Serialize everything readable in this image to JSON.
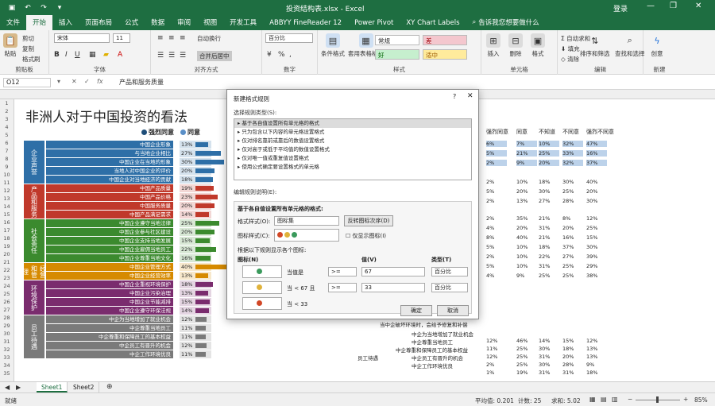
{
  "titlebar": {
    "title": "投资结构表.xlsx - Excel",
    "user": "登录",
    "min": "—",
    "restore": "❐",
    "close": "✕"
  },
  "tabs": [
    "文件",
    "开始",
    "插入",
    "页面布局",
    "公式",
    "数据",
    "审阅",
    "视图",
    "开发工具",
    "ABBYY FineReader 12",
    "Power Pivot",
    "XY Chart Labels"
  ],
  "tell_me": "告诉我您想要做什么",
  "ribbon": {
    "clipboard": {
      "label": "剪贴板",
      "paste": "粘贴",
      "cut": "剪切",
      "copy": "复制",
      "painter": "格式刷"
    },
    "font": {
      "label": "字体",
      "name": "宋体",
      "size": "11"
    },
    "align": {
      "label": "对齐方式",
      "wrap": "自动换行",
      "merge": "合并后居中"
    },
    "number": {
      "label": "数字",
      "format": "百分比"
    },
    "styles": {
      "label": "样式",
      "cond": "条件格式",
      "table": "套用表格格式",
      "normal": "常规",
      "bad": "差",
      "good": "好",
      "neutral": "适中"
    },
    "cells": {
      "label": "单元格",
      "insert": "插入",
      "delete": "删除",
      "format": "格式"
    },
    "editing": {
      "label": "编辑",
      "autosum": "自动求和",
      "fill": "填充",
      "clear": "清除",
      "sort": "排序和筛选",
      "find": "查找和选择"
    },
    "new_grp": {
      "label": "新建",
      "btn": "创意"
    }
  },
  "formula_bar": {
    "cell": "O12",
    "value": "产品和服务质量"
  },
  "sheet": {
    "title": "非洲人对于中国投资的看法",
    "legend": [
      "强烈同意",
      "同意"
    ],
    "categories": [
      {
        "name": "企业声誉",
        "color": "#2e6fa7"
      },
      {
        "name": "产品和服务",
        "color": "#c0392b"
      },
      {
        "name": "社会责任",
        "color": "#3b8a2e"
      },
      {
        "name": "经营和管理",
        "color": "#d68a00"
      },
      {
        "name": "环境保护",
        "color": "#7a2c6e"
      },
      {
        "name": "员工待遇",
        "color": "#7a7a7a"
      }
    ],
    "rows": [
      {
        "c": 0,
        "label": "中国企业形象",
        "pct": "13%",
        "v": 0.13
      },
      {
        "c": 0,
        "label": "与当地企业相比",
        "pct": "27%",
        "v": 0.27
      },
      {
        "c": 0,
        "label": "中国企业在当地的形象",
        "pct": "30%",
        "v": 0.3
      },
      {
        "c": 0,
        "label": "当地人对中国企业的评价",
        "pct": "20%",
        "v": 0.2
      },
      {
        "c": 0,
        "label": "中国企业对当地经济的贡献",
        "pct": "18%",
        "v": 0.18
      },
      {
        "c": 1,
        "label": "中国产品质量",
        "pct": "19%",
        "v": 0.19
      },
      {
        "c": 1,
        "label": "中国产品价格",
        "pct": "23%",
        "v": 0.23
      },
      {
        "c": 1,
        "label": "中国服务质量",
        "pct": "20%",
        "v": 0.2
      },
      {
        "c": 1,
        "label": "中国产品满足需求",
        "pct": "14%",
        "v": 0.14
      },
      {
        "c": 2,
        "label": "中国企业遵守当地法律",
        "pct": "25%",
        "v": 0.25
      },
      {
        "c": 2,
        "label": "中国企业参与社区建设",
        "pct": "20%",
        "v": 0.2
      },
      {
        "c": 2,
        "label": "中国企业支持当地发展",
        "pct": "15%",
        "v": 0.15
      },
      {
        "c": 2,
        "label": "中国企业雇佣当地员工",
        "pct": "22%",
        "v": 0.22
      },
      {
        "c": 2,
        "label": "中国企业尊重当地文化",
        "pct": "16%",
        "v": 0.16
      },
      {
        "c": 3,
        "label": "中国企业管理方式",
        "pct": "40%",
        "v": 0.4
      },
      {
        "c": 3,
        "label": "中国企业经营效率",
        "pct": "13%",
        "v": 0.13
      },
      {
        "c": 4,
        "label": "中国企业重视环境保护",
        "pct": "18%",
        "v": 0.18
      },
      {
        "c": 4,
        "label": "中国企业污染治理",
        "pct": "13%",
        "v": 0.13
      },
      {
        "c": 4,
        "label": "中国企业节能减排",
        "pct": "15%",
        "v": 0.15
      },
      {
        "c": 4,
        "label": "中国企业遵守环保法规",
        "pct": "14%",
        "v": 0.14
      },
      {
        "c": 5,
        "label": "中企为当地增加了就业机会",
        "pct": "12%",
        "v": 0.12
      },
      {
        "c": 5,
        "label": "中企尊重当地员工",
        "pct": "11%",
        "v": 0.11
      },
      {
        "c": 5,
        "label": "中企尊重和保障员工的基本权益",
        "pct": "11%",
        "v": 0.11
      },
      {
        "c": 5,
        "label": "中企员工有晋升的机会",
        "pct": "12%",
        "v": 0.12
      },
      {
        "c": 5,
        "label": "中企工作环境优良",
        "pct": "11%",
        "v": 0.11
      }
    ],
    "right_headers": [
      "强烈同意",
      "同意",
      "不知道",
      "不同意",
      "强烈不同意"
    ],
    "right_rows": [
      [
        "6%",
        "7%",
        "10%",
        "32%",
        "47%"
      ],
      [
        "5%",
        "21%",
        "25%",
        "33%",
        "16%"
      ],
      [
        "2%",
        "9%",
        "20%",
        "32%",
        "37%"
      ],
      [
        "2%",
        "10%",
        "18%",
        "30%",
        "40%"
      ],
      [
        "5%",
        "20%",
        "30%",
        "25%",
        "20%"
      ],
      [
        "2%",
        "13%",
        "27%",
        "28%",
        "30%"
      ],
      [
        "2%",
        "35%",
        "21%",
        "8%",
        "12%"
      ],
      [
        "4%",
        "20%",
        "31%",
        "20%",
        "25%"
      ],
      [
        "8%",
        "40%",
        "21%",
        "16%",
        "15%"
      ],
      [
        "5%",
        "10%",
        "18%",
        "37%",
        "30%"
      ],
      [
        "2%",
        "10%",
        "22%",
        "27%",
        "39%"
      ],
      [
        "5%",
        "10%",
        "31%",
        "25%",
        "29%"
      ],
      [
        "4%",
        "9%",
        "25%",
        "25%",
        "38%"
      ]
    ],
    "right_labels": [
      {
        "text": "当中企破坏环境时，会给予修复和补偿",
        "row": 12
      },
      {
        "text": "中企为当地增加了就业机会",
        "row": 13
      },
      {
        "text": "中企尊重当地员工",
        "row": 14
      },
      {
        "text": "中企尊重和保障员工的基本权益",
        "row": 15
      },
      {
        "text": "中企员工有晋升的机会",
        "row": 16
      },
      {
        "text": "中企工作环境优良",
        "row": 17
      }
    ],
    "right_tail": [
      [
        "12%",
        "46%",
        "14%",
        "15%",
        "12%"
      ],
      [
        "11%",
        "25%",
        "30%",
        "18%",
        "13%"
      ],
      [
        "12%",
        "25%",
        "31%",
        "20%",
        "13%"
      ],
      [
        "2%",
        "25%",
        "30%",
        "28%",
        "9%"
      ],
      [
        "1%",
        "19%",
        "31%",
        "31%",
        "18%"
      ]
    ],
    "right_cat": "员工待遇"
  },
  "dialog": {
    "title": "新建格式规则",
    "help": "?",
    "close": "✕",
    "select_label": "选择规则类型(S):",
    "rules": [
      "基于各自值设置所有单元格的格式",
      "只为包含以下内容的单元格设置格式",
      "仅对排名靠前或靠后的数值设置格式",
      "仅对高于或低于平均值的数值设置格式",
      "仅对唯一值或重复值设置格式",
      "使用公式确定要设置格式的单元格"
    ],
    "edit_label": "编辑规则说明(E):",
    "sub_label": "基于各自值设置所有单元格的格式:",
    "style_label": "格式样式(O):",
    "style_value": "图标集",
    "reverse_btn": "反转图标次序(D)",
    "icon_style_label": "图标样式(C):",
    "show_icon_only": "仅显示图标(I)",
    "rule_desc": "根据以下规则显示各个图标:",
    "col_icon": "图标(N)",
    "col_value": "值(V)",
    "col_type": "类型(T)",
    "r1_when": "当值是",
    "r1_op": ">=",
    "r1_val": "67",
    "r1_type": "百分比",
    "r2_when": "当 < 67 且",
    "r2_op": ">=",
    "r2_val": "33",
    "r2_type": "百分比",
    "r3_when": "当 < 33",
    "ok": "确定",
    "cancel": "取消",
    "colors": {
      "green": "#3a9a5c",
      "yellow": "#e0b23a",
      "red": "#d24726"
    }
  },
  "sheet_tabs": [
    "Sheet1",
    "Sheet2"
  ],
  "status": {
    "ready": "就绪",
    "avg": "平均值: 0.201",
    "count": "计数: 25",
    "sum": "求和: 5.02",
    "zoom": "85%"
  }
}
